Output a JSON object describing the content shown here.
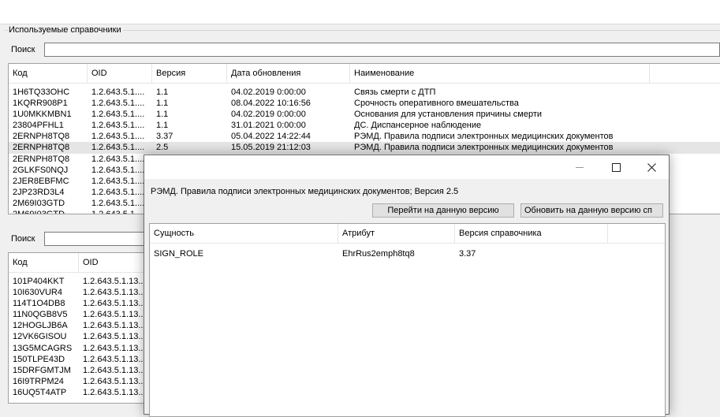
{
  "main": {
    "group_title": "Используемые справочники",
    "search1_label": "Поиск",
    "search1_value": "",
    "search2_label": "Поиск",
    "search2_value": "",
    "grid1": {
      "headers": [
        "Код",
        "OID",
        "Версия",
        "Дата обновления",
        "Наименование"
      ],
      "rows": [
        [
          "1H6TQ33OHC",
          "1.2.643.5.1....",
          "1.1",
          "04.02.2019 0:00:00",
          "Связь смерти с ДТП"
        ],
        [
          "1KQRR908P1",
          "1.2.643.5.1....",
          "1.1",
          "08.04.2022 10:16:56",
          "Срочность оперативного вмешательства"
        ],
        [
          "1U0MKKMBN1",
          "1.2.643.5.1....",
          "1.1",
          "04.02.2019 0:00:00",
          "Основания для установления причины смерти"
        ],
        [
          "23804PFHL1",
          "1.2.643.5.1....",
          "1.1",
          "31.01.2021 0:00:00",
          "ДС. Диспансерное наблюдение"
        ],
        [
          "2ERNPH8TQ8",
          "1.2.643.5.1....",
          "3.37",
          "05.04.2022 14:22:44",
          "РЭМД. Правила подписи электронных медицинских документов"
        ],
        [
          "2ERNPH8TQ8",
          "1.2.643.5.1....",
          "2.5",
          "15.05.2019 21:12:03",
          "РЭМД. Правила подписи электронных медицинских документов"
        ],
        [
          "2ERNPH8TQ8",
          "1.2.643.5.1....",
          "",
          "",
          ""
        ],
        [
          "2GLKFS0NQJ",
          "1.2.643.5.1....",
          "",
          "",
          ""
        ],
        [
          "2JER8EBFMC",
          "1.2.643.5.1....",
          "",
          "",
          ""
        ],
        [
          "2JP23RD3L4",
          "1.2.643.5.1....",
          "",
          "",
          ""
        ],
        [
          "2M69I03GTD",
          "1.2.643.5.1....",
          "",
          "",
          ""
        ],
        [
          "2M69I03GTD",
          "1.2.643.5.1",
          "",
          "",
          ""
        ]
      ]
    },
    "grid2": {
      "headers": [
        "Код",
        "OID"
      ],
      "rows": [
        [
          "101P404KKT",
          "1.2.643.5.1.13...."
        ],
        [
          "10I630VUR4",
          "1.2.643.5.1.13...."
        ],
        [
          "114T1O4DB8",
          "1.2.643.5.1.13...."
        ],
        [
          "11N0QGB8V5",
          "1.2.643.5.1.13...."
        ],
        [
          "12HOGLJB6A",
          "1.2.643.5.1.13...."
        ],
        [
          "12VK6GISOU",
          "1.2.643.5.1.13...."
        ],
        [
          "13G5MCAGRS",
          "1.2.643.5.1.13...."
        ],
        [
          "150TLPE43D",
          "1.2.643.5.1.13...."
        ],
        [
          "15DRFGMTJM",
          "1.2.643.5.1.13...."
        ],
        [
          "16I9TRPM24",
          "1.2.643.5.1.13...."
        ],
        [
          "16UQ5T4ATP",
          "1.2.643.5.1.13...."
        ]
      ]
    }
  },
  "dialog": {
    "info_text": "РЭМД. Правила подписи электронных медицинских документов; Версия 2.5",
    "goto_button": "Перейти на данную версию",
    "update_button": "Обновить  на  данную версию сп",
    "grid": {
      "headers": [
        "Сущность",
        "Атрибут",
        "Версия справочника"
      ],
      "rows": [
        [
          "SIGN_ROLE",
          "EhrRus2emph8tq8",
          "3.37"
        ]
      ]
    },
    "window_buttons": {
      "minimize": "—",
      "maximize": "☐",
      "close": "✕"
    }
  }
}
